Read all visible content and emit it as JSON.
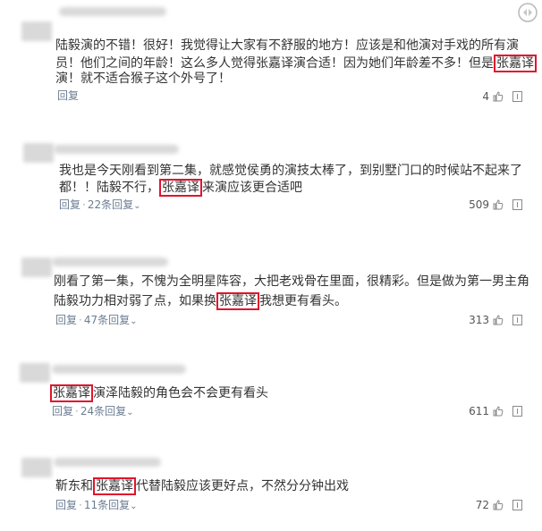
{
  "comments": [
    {
      "lines": [
        {
          "before": "陆毅演的不错！很好！我觉得让大家有不舒服的地方！应该是和他演对手戏的所有演",
          "hl": "",
          "after": ""
        },
        {
          "before": "员！他们之间的年龄！这么多人觉得张嘉译演合适！因为她们年龄差不多！但是",
          "hl": "张嘉译",
          "after": ""
        },
        {
          "before": "演！就不适合猴子这个外号了！",
          "hl": "",
          "after": ""
        }
      ],
      "reply": "回复",
      "sub_replies": "",
      "likes": "4"
    },
    {
      "lines": [
        {
          "before": "我也是今天刚看到第二集，就感觉侯勇的演技太棒了，到别墅门口的时候站不起来了",
          "hl": "",
          "after": ""
        },
        {
          "before": "都！！陆毅不行，",
          "hl": "张嘉译",
          "after": "来演应该更合适吧"
        }
      ],
      "reply": "回复",
      "sub_replies": "22条回复",
      "likes": "509"
    },
    {
      "lines": [
        {
          "before": "刚看了第一集，不愧为全明星阵容，大把老戏骨在里面，很精彩。但是做为第一男主角",
          "hl": "",
          "after": ""
        },
        {
          "before": "陆毅功力相对弱了点，如果换",
          "hl": "张嘉译",
          "after": "我想更有看头。"
        }
      ],
      "reply": "回复",
      "sub_replies": "47条回复",
      "likes": "313"
    },
    {
      "lines": [
        {
          "before": "",
          "hl": "张嘉译",
          "after": "演泽陆毅的角色会不会更有看头"
        }
      ],
      "reply": "回复",
      "sub_replies": "24条回复",
      "likes": "611"
    },
    {
      "lines": [
        {
          "before": "靳东和",
          "hl": "张嘉译",
          "after": "代替陆毅应该更好点，不然分分钟出戏"
        }
      ],
      "reply": "回复",
      "sub_replies": "11条回复",
      "likes": "72"
    }
  ],
  "colors": {
    "highlight": "#e0142c",
    "meta": "#6b7d93",
    "text": "#333333"
  },
  "icons": [
    "watermark-icon",
    "thumbs-up-icon",
    "report-icon",
    "chevron-down-icon"
  ]
}
